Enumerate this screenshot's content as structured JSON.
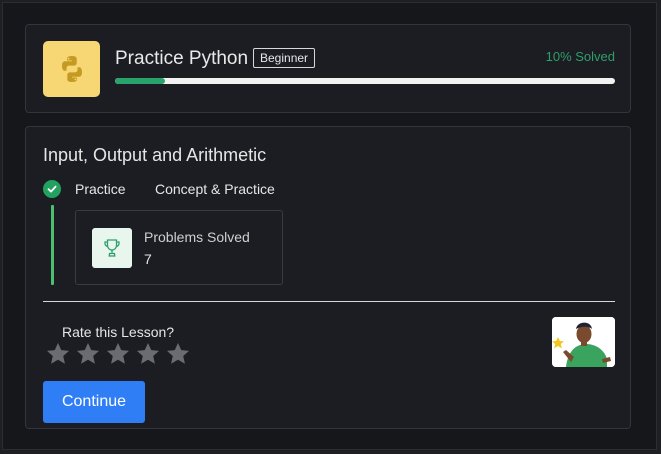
{
  "course": {
    "title": "Practice Python",
    "level": "Beginner",
    "solved_text": "10% Solved",
    "progress_percent": 10,
    "logo_icon": "python-logo-icon"
  },
  "lesson": {
    "title": "Input, Output and Arithmetic",
    "tabs": [
      {
        "label": "Practice",
        "completed": true
      },
      {
        "label": "Concept & Practice",
        "completed": false
      }
    ],
    "stat": {
      "label": "Problems Solved",
      "value": "7",
      "icon": "trophy-icon"
    },
    "rating": {
      "label": "Rate this Lesson?",
      "max_stars": 5,
      "selected": 0
    },
    "continue_label": "Continue"
  },
  "colors": {
    "accent_green": "#27a36b",
    "button_blue": "#2f7ef6",
    "logo_bg": "#f6d774"
  }
}
